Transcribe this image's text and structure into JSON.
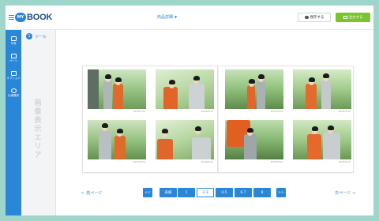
{
  "header": {
    "logo_badge": "MY",
    "logo_text": "BOOK",
    "title": "商品詳細",
    "save_label": "保存する",
    "order_label": "注文する"
  },
  "rail": {
    "items": [
      {
        "label": "写真",
        "icon": "photo-icon"
      },
      {
        "label": "ページ",
        "icon": "page-icon"
      },
      {
        "label": "オプション",
        "icon": "book-icon"
      },
      {
        "label": "仕様選択",
        "icon": "palette-icon"
      }
    ]
  },
  "panel": {
    "tab_number": "1",
    "tab_label": "ツール",
    "vertical_text": "画像表示エリア"
  },
  "book": {
    "dates": [
      "2019/5/10",
      "2019/5/10",
      "2019/5/10",
      "2019/5/10",
      "2019/5/10",
      "2019/5/10",
      "2019/5/10",
      "2019/5/10"
    ]
  },
  "pager": {
    "prev_label": "前ページ",
    "next_label": "次ページ",
    "first": "<<",
    "last": ">>",
    "pages": [
      "表紙",
      "1",
      "2-3",
      "4-5",
      "6-7",
      "8"
    ],
    "active": "2-3"
  },
  "colors": {
    "accent": "#2a86d6",
    "order_button": "#7bc42c",
    "frame": "#9fd6cc"
  }
}
